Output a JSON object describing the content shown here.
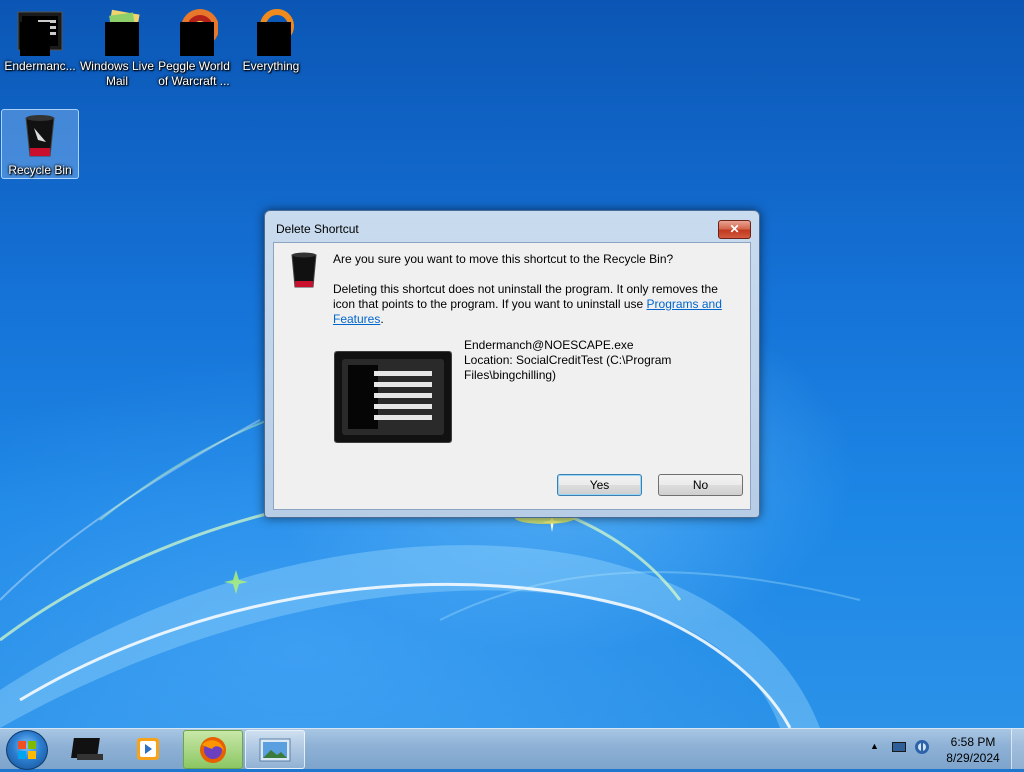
{
  "desktop": {
    "icons": [
      {
        "label": "Endermanc...",
        "icon": "endermanch-app-icon"
      },
      {
        "label": "Windows Live\nMail",
        "icon": "mail-icon"
      },
      {
        "label": "Peggle World\nof Warcraft ...",
        "icon": "peggle-icon"
      },
      {
        "label": "Everything",
        "icon": "everything-search-icon"
      },
      {
        "label": "Recycle Bin",
        "icon": "recycle-bin-icon"
      }
    ]
  },
  "dialog": {
    "title": "Delete Shortcut",
    "close_label": "✕",
    "main_instruction": "Are you sure you want to move this shortcut to the Recycle Bin?",
    "description_prefix": "Deleting this shortcut does not uninstall the program. It only removes the icon that points to the program. If you want to uninstall use ",
    "link_text": "Programs and Features",
    "description_suffix": ".",
    "file_name": "Endermanch@NOESCAPE.exe",
    "location": "Location: SocialCreditTest (C:\\Program Files\\bingchilling)",
    "yes_label": "Yes",
    "no_label": "No"
  },
  "taskbar": {
    "items": [
      {
        "icon": "start-orb-icon"
      },
      {
        "icon": "black-app-icon"
      },
      {
        "icon": "media-player-icon"
      },
      {
        "icon": "firefox-icon"
      },
      {
        "icon": "picture-viewer-icon"
      }
    ],
    "tray_icons": [
      "show-hidden-icons-icon",
      "display-icon",
      "network-icon"
    ],
    "time": "6:58 PM",
    "date": "8/29/2024"
  }
}
